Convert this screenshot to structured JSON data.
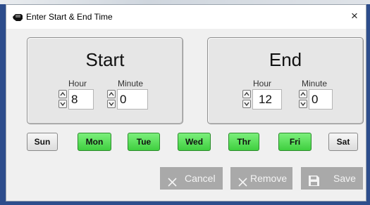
{
  "dialog": {
    "title": "Enter Start & End Time",
    "close_glyph": "×"
  },
  "start": {
    "title": "Start",
    "hour_label": "Hour",
    "minute_label": "Minute",
    "hour_value": "8",
    "minute_value": "0"
  },
  "end": {
    "title": "End",
    "hour_label": "Hour",
    "minute_label": "Minute",
    "hour_value": "12",
    "minute_value": "0"
  },
  "days": [
    {
      "label": "Sun",
      "selected": false
    },
    {
      "label": "Mon",
      "selected": true
    },
    {
      "label": "Tue",
      "selected": true
    },
    {
      "label": "Wed",
      "selected": true
    },
    {
      "label": "Thr",
      "selected": true
    },
    {
      "label": "Fri",
      "selected": true
    },
    {
      "label": "Sat",
      "selected": false
    }
  ],
  "actions": {
    "cancel": "Cancel",
    "remove": "Remove",
    "save": "Save"
  },
  "icons": {
    "title": "hand-icon",
    "cancel": "close-icon",
    "remove": "close-icon",
    "save": "floppy-disk-icon"
  },
  "colors": {
    "selected_day": "#4ad84a",
    "button_disabled": "#a9a9a9"
  }
}
